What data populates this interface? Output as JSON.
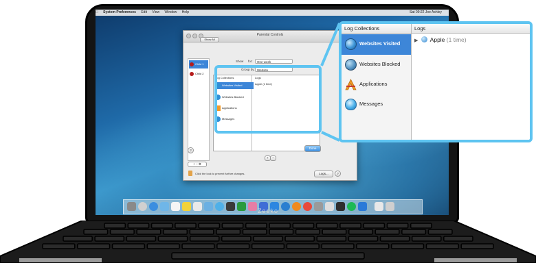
{
  "menubar": {
    "app": "System Preferences",
    "items": [
      "Edit",
      "View",
      "Window",
      "Help"
    ],
    "status": "Sat 09:22   Joe Ashley"
  },
  "window": {
    "title": "Parental Controls",
    "show_all": "Show All",
    "children": [
      "Child 1",
      "Child 2"
    ],
    "show_label": "Show",
    "show_value": "One week",
    "group_by_label": "Group by:",
    "group_by_value": "Website",
    "done_button": "Done",
    "logs_button": "Logs...",
    "lock_text": "Click the lock to prevent further changes.",
    "help": "?"
  },
  "small_panel": {
    "collections_header": "Log Collections",
    "logs_header": "Logs",
    "items": [
      "Websites Visited",
      "Websites Blocked",
      "Applications",
      "Messages"
    ],
    "log_entry": "Apple (1 time)"
  },
  "callout": {
    "collections_header": "Log Collections",
    "logs_header": "Logs",
    "items": [
      {
        "label": "Websites Visited",
        "icon": "globe-icon",
        "selected": true
      },
      {
        "label": "Websites Blocked",
        "icon": "blocked-globe-icon",
        "selected": false
      },
      {
        "label": "Applications",
        "icon": "applications-icon",
        "selected": false
      },
      {
        "label": "Messages",
        "icon": "messages-icon",
        "selected": false
      }
    ],
    "log_entry": {
      "name": "Apple",
      "count": "(1 time)"
    }
  },
  "device": {
    "brand": "Zeeko"
  },
  "colors": {
    "highlight": "#5ec4f1",
    "selection": "#3d86d8"
  }
}
